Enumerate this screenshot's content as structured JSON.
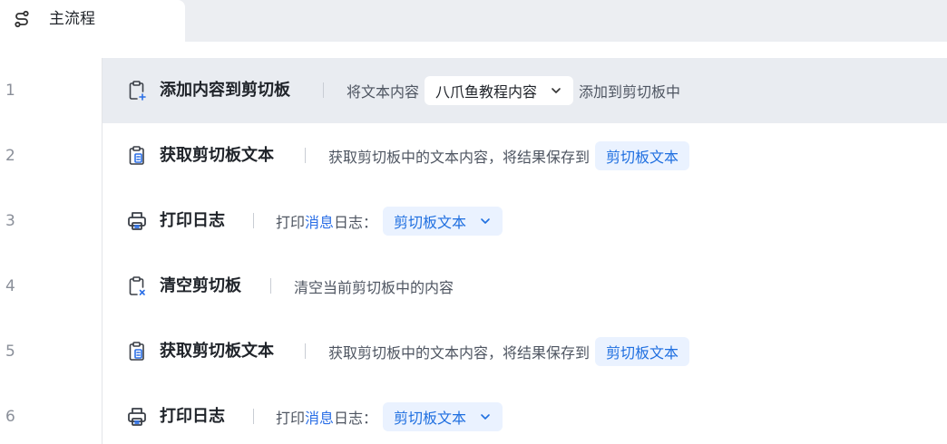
{
  "tab": {
    "title": "主流程",
    "icon": "flow-icon"
  },
  "rows": [
    {
      "line": "1",
      "title": "添加内容到剪切板",
      "icon": "clipboard-add-icon",
      "desc_before": "将文本内容",
      "chip": "八爪鱼教程内容",
      "desc_after": "添加到剪切板中",
      "highlighted": true
    },
    {
      "line": "2",
      "title": "获取剪切板文本",
      "icon": "clipboard-text-icon",
      "desc_before": "获取剪切板中的文本内容，将结果保存到",
      "chip": "剪切板文本"
    },
    {
      "line": "3",
      "title": "打印日志",
      "icon": "printer-icon",
      "desc_before": "打印",
      "desc_link": "消息",
      "desc_mid": "日志：",
      "chip": "剪切板文本"
    },
    {
      "line": "4",
      "title": "清空剪切板",
      "icon": "clipboard-clear-icon",
      "desc_before": "清空当前剪切板中的内容"
    },
    {
      "line": "5",
      "title": "获取剪切板文本",
      "icon": "clipboard-text-icon",
      "desc_before": "获取剪切板中的文本内容，将结果保存到",
      "chip": "剪切板文本"
    },
    {
      "line": "6",
      "title": "打印日志",
      "icon": "printer-icon",
      "desc_before": "打印",
      "desc_link": "消息",
      "desc_mid": "日志：",
      "chip": "剪切板文本"
    }
  ],
  "colors": {
    "accent": "#1f6fe0",
    "chip_bg": "#eaf2ff",
    "highlight_row": "#e9ecf1"
  }
}
